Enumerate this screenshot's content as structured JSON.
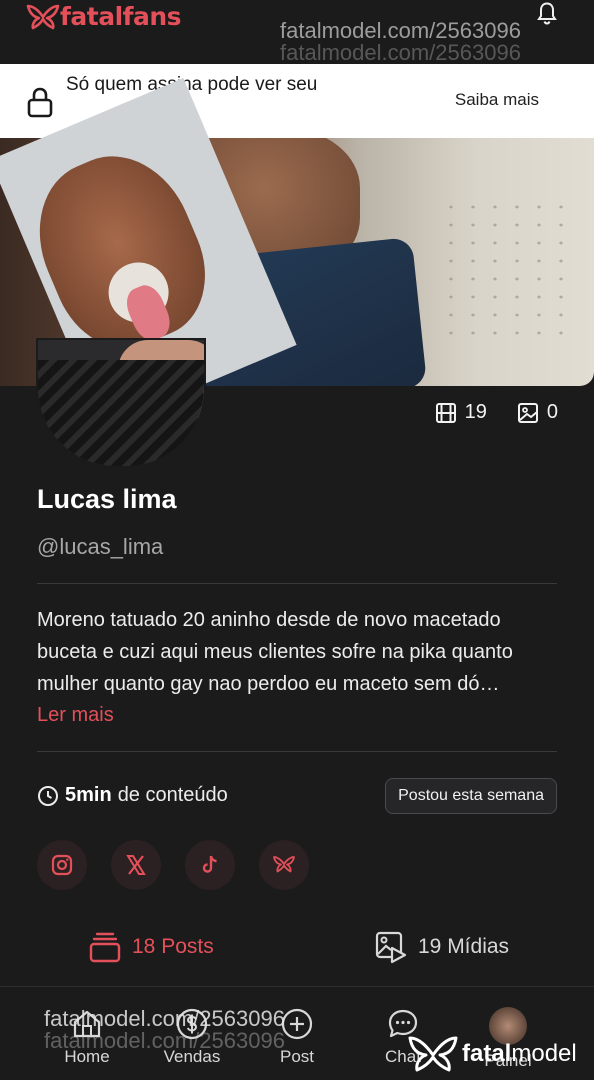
{
  "header": {
    "logo_text": "fatalfans",
    "brand_color": "#e4505a",
    "bell_icon": "bell-icon"
  },
  "watermark": {
    "top_text": "fatalmodel.com/2563096",
    "bottom_text": "fatalmodel.com/2563096",
    "logo_prefix": "fatal",
    "logo_suffix": "model"
  },
  "lock_banner": {
    "text": "Só quem assina pode ver seu",
    "action": "Saiba mais"
  },
  "profile": {
    "video_count": "19",
    "image_count": "0",
    "name": "Lucas lima",
    "handle": "@lucas_lima",
    "bio": "Moreno tatuado 20 aninho desde de novo macetado buceta e cuzi aqui meus clientes sofre na pika quanto mulher quanto gay nao perdoo eu maceto sem dó…",
    "read_more": "Ler mais",
    "duration_value": "5min",
    "duration_label": "de conteúdo",
    "posted_badge": "Postou esta semana"
  },
  "socials": [
    "instagram-icon",
    "x-icon",
    "tiktok-icon",
    "fatal-icon"
  ],
  "tabs": {
    "posts_label": "18 Posts",
    "media_label": "19 Mídias"
  },
  "bottom_nav": {
    "home": "Home",
    "vendas": "Vendas",
    "post": "Post",
    "chat": "Chat",
    "painel": "Painel"
  }
}
